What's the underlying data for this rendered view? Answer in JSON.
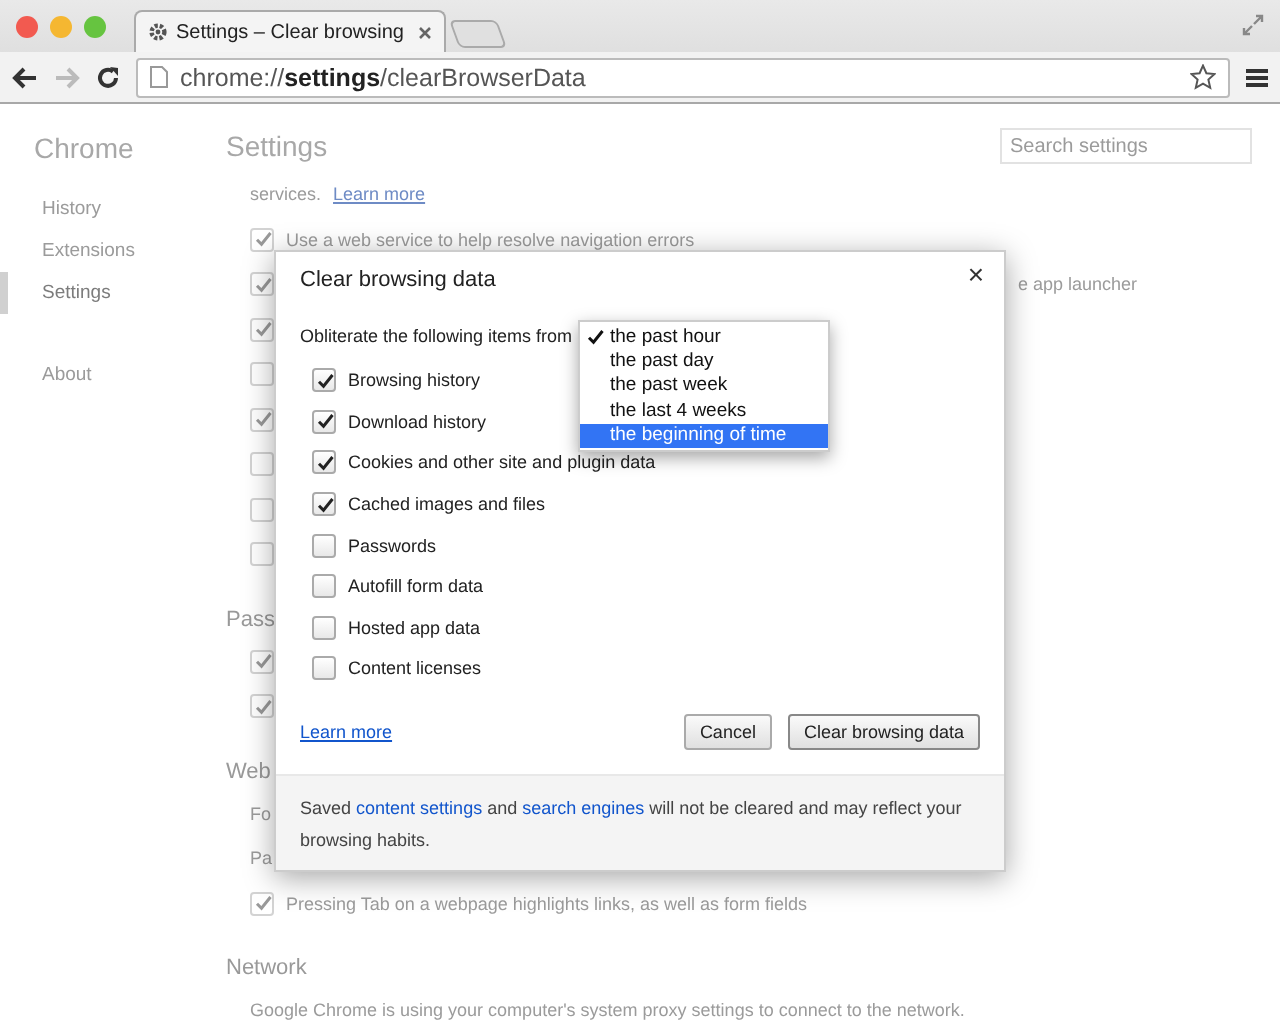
{
  "browser": {
    "tab": {
      "title": "Settings – Clear browsing"
    },
    "address": "chrome://**settings**/clearBrowserData",
    "forward_disabled": true
  },
  "sidebar": {
    "title": "Chrome",
    "items": [
      {
        "label": "History",
        "selected": false
      },
      {
        "label": "Extensions",
        "selected": false
      },
      {
        "label": "Settings",
        "selected": true
      },
      {
        "label": "About",
        "selected": false
      }
    ]
  },
  "page": {
    "title": "Settings",
    "search": {
      "placeholder": "Search settings"
    },
    "rows": [
      {
        "kind": "text",
        "text": "services.",
        "link": "Learn more"
      },
      {
        "kind": "checkbox",
        "checked": true,
        "text": "Use a web service to help resolve navigation errors"
      },
      {
        "kind": "checkbox_right",
        "checked": true,
        "text": "e app launcher"
      },
      {
        "kind": "checkbox",
        "checked": true
      },
      {
        "kind": "checkbox",
        "checked": false
      },
      {
        "kind": "checkbox",
        "checked": true
      },
      {
        "kind": "checkbox",
        "checked": false
      },
      {
        "kind": "checkbox",
        "checked": false
      },
      {
        "kind": "checkbox",
        "checked": false
      },
      {
        "kind": "heading",
        "text": "Pass"
      },
      {
        "kind": "checkbox",
        "checked": true
      },
      {
        "kind": "checkbox",
        "checked": true
      },
      {
        "kind": "heading",
        "text": "Web"
      },
      {
        "kind": "text",
        "text": "Fo"
      },
      {
        "kind": "text",
        "text": "Pa"
      },
      {
        "kind": "checkbox",
        "checked": true,
        "text": "Pressing Tab on a webpage highlights links, as well as form fields"
      },
      {
        "kind": "heading",
        "text": "Network"
      },
      {
        "kind": "text",
        "text": "Google Chrome is using your computer's system proxy settings to connect to the network."
      }
    ]
  },
  "dialog": {
    "title": "Clear browsing data",
    "close": "×",
    "period_label": "Obliterate the following items from",
    "period_options": [
      {
        "label": "the past hour",
        "checked": true,
        "selected": false
      },
      {
        "label": "the past day",
        "checked": false,
        "selected": false
      },
      {
        "label": "the past week",
        "checked": false,
        "selected": false
      },
      {
        "label": "the last 4 weeks",
        "checked": false,
        "selected": false
      },
      {
        "label": "the beginning of time",
        "checked": false,
        "selected": true
      }
    ],
    "items": [
      {
        "label": "Browsing history",
        "checked": true
      },
      {
        "label": "Download history",
        "checked": true
      },
      {
        "label": "Cookies and other site and plugin data",
        "checked": true
      },
      {
        "label": "Cached images and files",
        "checked": true
      },
      {
        "label": "Passwords",
        "checked": false
      },
      {
        "label": "Autofill form data",
        "checked": false
      },
      {
        "label": "Hosted app data",
        "checked": false
      },
      {
        "label": "Content licenses",
        "checked": false
      }
    ],
    "learn_more": "Learn more",
    "buttons": [
      {
        "label": "Cancel",
        "kind": "cancel"
      },
      {
        "label": "Clear browsing data",
        "kind": "primary"
      }
    ],
    "footer": [
      {
        "kind": "text",
        "text": "Saved "
      },
      {
        "kind": "link",
        "text": "content settings"
      },
      {
        "kind": "text",
        "text": " and "
      },
      {
        "kind": "link",
        "text": "search engines"
      },
      {
        "kind": "text",
        "text": " will not be cleared and may reflect your browsing habits."
      }
    ]
  }
}
